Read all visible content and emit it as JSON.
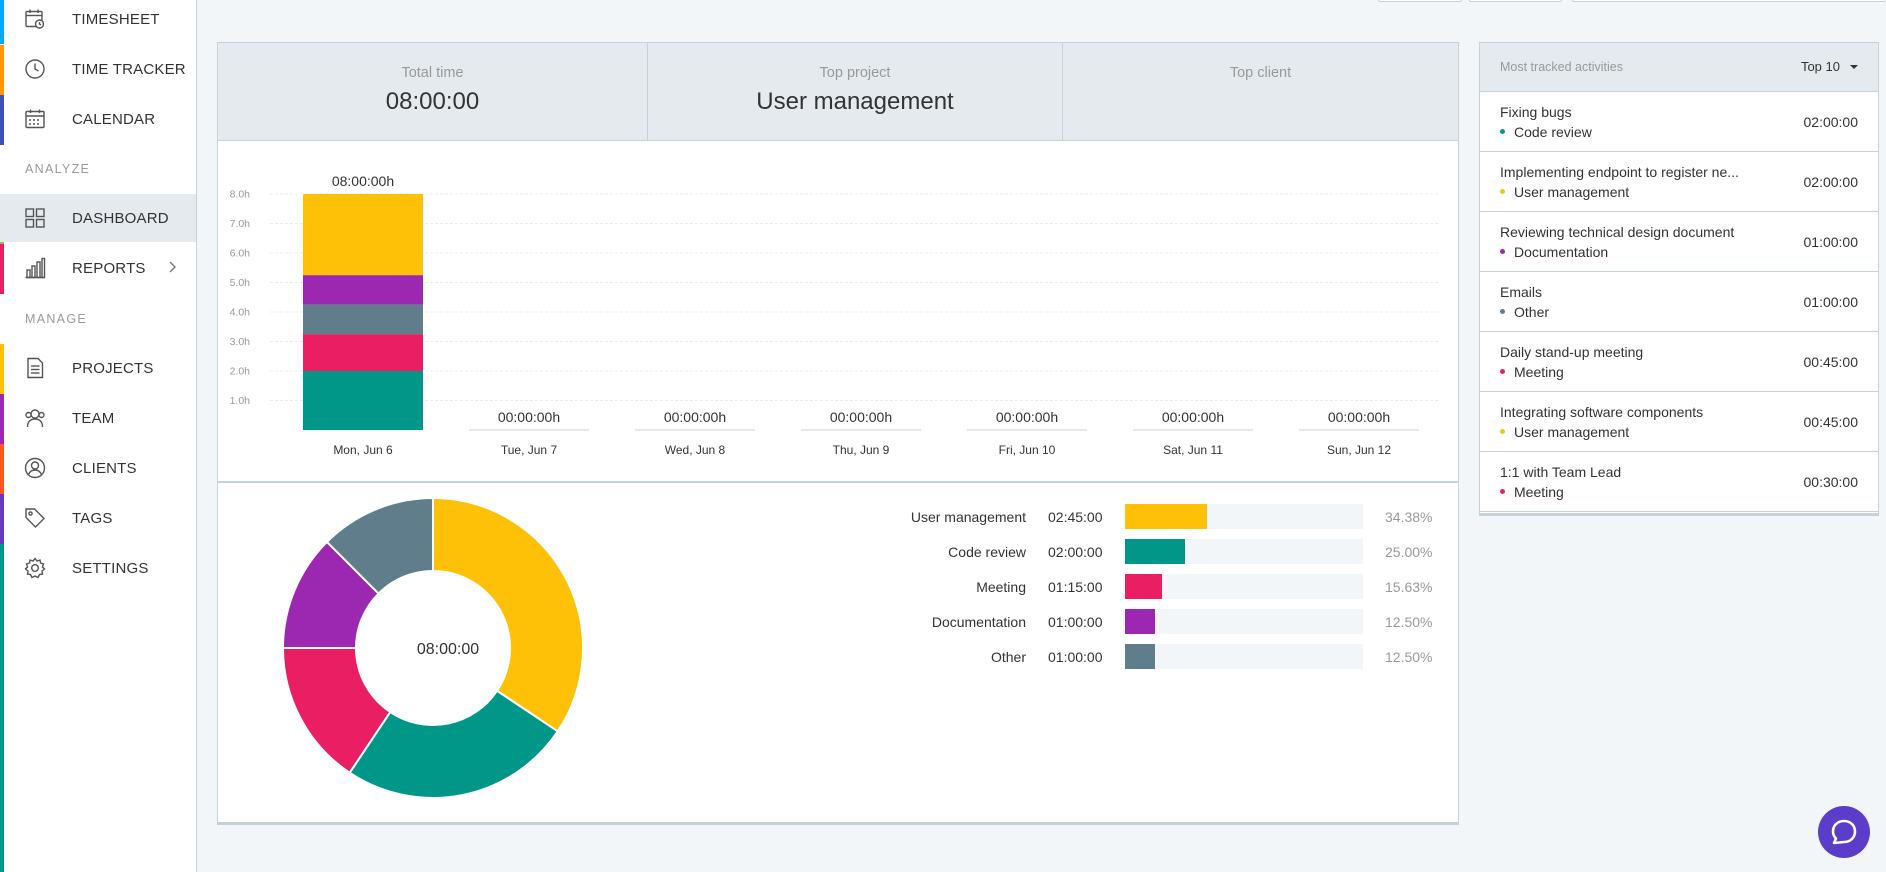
{
  "sidebar": {
    "items": [
      {
        "label": "TIMESHEET",
        "icon": "timesheet-icon",
        "stripe": "#03a9f4"
      },
      {
        "label": "TIME TRACKER",
        "icon": "clock-icon",
        "stripe": "#ff9800"
      },
      {
        "label": "CALENDAR",
        "icon": "calendar-icon",
        "stripe": "#3f51b5"
      },
      {
        "label": "DASHBOARD",
        "icon": "dashboard-icon",
        "stripe": "#8bc34a",
        "active": true
      },
      {
        "label": "REPORTS",
        "icon": "reports-icon",
        "stripe": "#e91e63"
      },
      {
        "label": "PROJECTS",
        "icon": "projects-icon",
        "stripe": "#ffc107"
      },
      {
        "label": "TEAM",
        "icon": "team-icon",
        "stripe": "#9c27b0"
      },
      {
        "label": "CLIENTS",
        "icon": "clients-icon",
        "stripe": "#ff5722"
      },
      {
        "label": "TAGS",
        "icon": "tag-icon",
        "stripe": "#673ab7"
      },
      {
        "label": "SETTINGS",
        "icon": "gear-icon",
        "stripe": "#009688"
      }
    ],
    "sections": {
      "analyze": "ANALYZE",
      "manage": "MANAGE"
    }
  },
  "summary": {
    "total_time": {
      "label": "Total time",
      "value": "08:00:00"
    },
    "top_project": {
      "label": "Top project",
      "value": "User management"
    },
    "top_client": {
      "label": "Top client",
      "value": ""
    }
  },
  "chart_data": [
    {
      "type": "bar",
      "title": "",
      "categories": [
        "Mon, Jun 6",
        "Tue, Jun 7",
        "Wed, Jun 8",
        "Thu, Jun 9",
        "Fri, Jun 10",
        "Sat, Jun 11",
        "Sun, Jun 12"
      ],
      "totals": [
        "08:00:00h",
        "00:00:00h",
        "00:00:00h",
        "00:00:00h",
        "00:00:00h",
        "00:00:00h",
        "00:00:00h"
      ],
      "y_ticks": [
        "1.0h",
        "2.0h",
        "3.0h",
        "4.0h",
        "5.0h",
        "6.0h",
        "7.0h",
        "8.0h"
      ],
      "ylim": [
        0,
        8
      ],
      "stacked": true,
      "series": [
        {
          "name": "Code review",
          "color": "#009688",
          "values": [
            2.0,
            0,
            0,
            0,
            0,
            0,
            0
          ]
        },
        {
          "name": "Meeting",
          "color": "#e91e63",
          "values": [
            1.25,
            0,
            0,
            0,
            0,
            0,
            0
          ]
        },
        {
          "name": "Other",
          "color": "#607d8b",
          "values": [
            1.0,
            0,
            0,
            0,
            0,
            0,
            0
          ]
        },
        {
          "name": "Documentation",
          "color": "#9c27b0",
          "values": [
            1.0,
            0,
            0,
            0,
            0,
            0,
            0
          ]
        },
        {
          "name": "User management",
          "color": "#ffc107",
          "values": [
            2.75,
            0,
            0,
            0,
            0,
            0,
            0
          ]
        }
      ]
    },
    {
      "type": "pie",
      "donut": true,
      "center_label": "08:00:00",
      "slices": [
        {
          "name": "User management",
          "time": "02:45:00",
          "percent": 34.38,
          "pct_label": "34.38%",
          "color": "#ffc107"
        },
        {
          "name": "Code review",
          "time": "02:00:00",
          "percent": 25.0,
          "pct_label": "25.00%",
          "color": "#009688"
        },
        {
          "name": "Meeting",
          "time": "01:15:00",
          "percent": 15.63,
          "pct_label": "15.63%",
          "color": "#e91e63"
        },
        {
          "name": "Documentation",
          "time": "01:00:00",
          "percent": 12.5,
          "pct_label": "12.50%",
          "color": "#9c27b0"
        },
        {
          "name": "Other",
          "time": "01:00:00",
          "percent": 12.5,
          "pct_label": "12.50%",
          "color": "#607d8b"
        }
      ]
    }
  ],
  "activities": {
    "title": "Most tracked activities",
    "filter": "Top 10",
    "items": [
      {
        "title": "Fixing bugs",
        "project": "Code review",
        "color": "#009688",
        "time": "02:00:00"
      },
      {
        "title": "Implementing endpoint to register ne...",
        "project": "User management",
        "color": "#ffc107",
        "time": "02:00:00"
      },
      {
        "title": "Reviewing technical design document",
        "project": "Documentation",
        "color": "#9c27b0",
        "time": "01:00:00"
      },
      {
        "title": "Emails",
        "project": "Other",
        "color": "#607d8b",
        "time": "01:00:00"
      },
      {
        "title": "Daily stand-up meeting",
        "project": "Meeting",
        "color": "#e91e63",
        "time": "00:45:00"
      },
      {
        "title": "Integrating software components",
        "project": "User management",
        "color": "#ffc107",
        "time": "00:45:00"
      },
      {
        "title": "1:1 with Team Lead",
        "project": "Meeting",
        "color": "#e91e63",
        "time": "00:30:00"
      }
    ]
  },
  "chat": {
    "icon": "chat-icon"
  }
}
